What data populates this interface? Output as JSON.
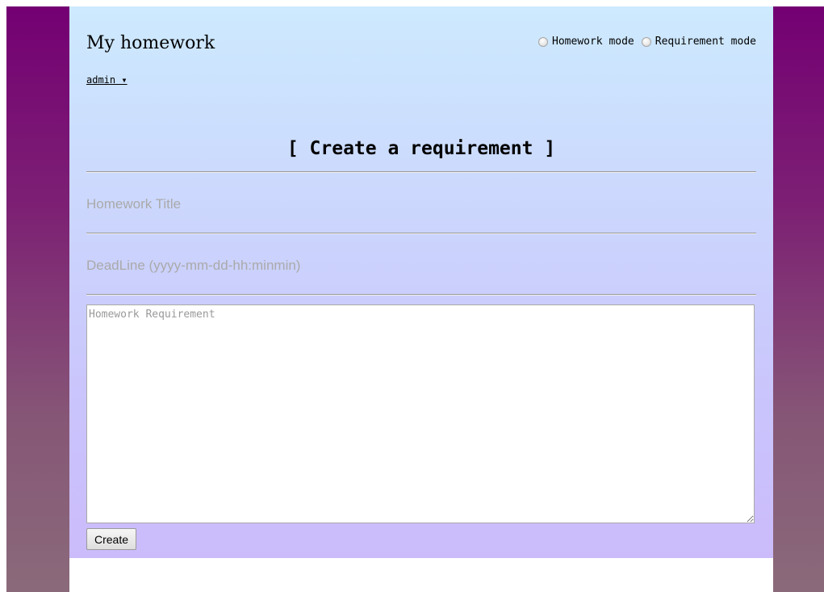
{
  "header": {
    "title": "My homework",
    "user_menu": "admin ▾"
  },
  "mode_switch": {
    "options": [
      {
        "label": "Homework mode",
        "checked": false
      },
      {
        "label": "Requirement mode",
        "checked": false
      }
    ]
  },
  "form": {
    "heading": "[ Create a requirement ]",
    "title_placeholder": "Homework Title",
    "deadline_placeholder": "DeadLine (yyyy-mm-dd-hh:minmin)",
    "requirement_placeholder": "Homework Requirement",
    "submit_label": "Create"
  },
  "colors": {
    "backdrop_top": "#740073",
    "backdrop_bottom": "#8a6a7a",
    "panel_top": "#cdeafe",
    "panel_bottom": "#cbbbfb"
  }
}
